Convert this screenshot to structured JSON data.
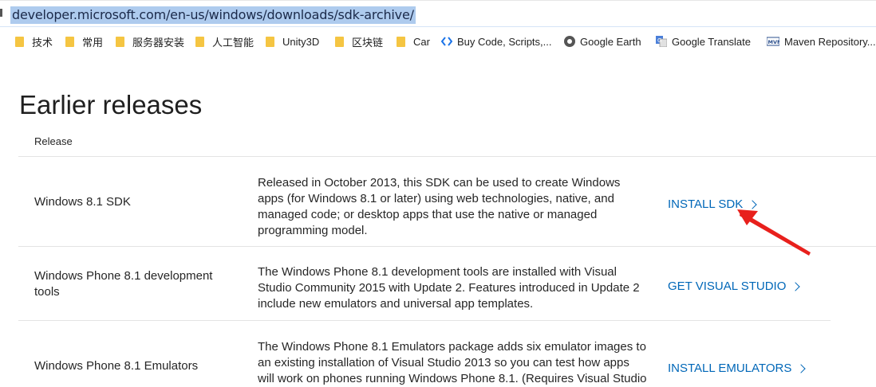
{
  "browser": {
    "url": "developer.microsoft.com/en-us/windows/downloads/sdk-archive/",
    "bookmarks": [
      {
        "label": "技术",
        "icon": "folder-icon"
      },
      {
        "label": "常用",
        "icon": "folder-icon"
      },
      {
        "label": "服务器安装",
        "icon": "folder-icon"
      },
      {
        "label": "人工智能",
        "icon": "folder-icon"
      },
      {
        "label": "Unity3D",
        "icon": "folder-icon"
      },
      {
        "label": "区块链",
        "icon": "folder-icon"
      },
      {
        "label": "Car",
        "icon": "folder-icon"
      },
      {
        "label": "Buy Code, Scripts,...",
        "icon": "codecanyon-icon"
      },
      {
        "label": "Google Earth",
        "icon": "globe-icon"
      },
      {
        "label": "Google Translate",
        "icon": "translate-icon"
      },
      {
        "label": "Maven Repository...",
        "icon": "maven-icon"
      }
    ]
  },
  "page": {
    "title": "Earlier releases",
    "column_header": "Release",
    "rows": [
      {
        "name": "Windows 8.1 SDK",
        "description": "Released in October 2013, this SDK can be used to create Windows apps (for Windows 8.1 or later) using web technologies, native, and managed code; or desktop apps that use the native or managed programming model.",
        "action": "INSTALL SDK"
      },
      {
        "name": "Windows Phone 8.1 development tools",
        "description": "The Windows Phone 8.1 development tools are installed with Visual Studio Community 2015 with Update 2. Features introduced in Update 2 include new emulators and universal app templates.",
        "action": "GET VISUAL STUDIO"
      },
      {
        "name": "Windows Phone 8.1 Emulators",
        "description": "The Windows Phone 8.1 Emulators package adds six emulator images to an existing installation of Visual Studio 2013 so you can test how apps will work on phones running Windows Phone 8.1. (Requires Visual Studio",
        "action": "INSTALL EMULATORS"
      }
    ]
  },
  "colors": {
    "link": "#0067b8",
    "url_highlight": "#aecbee",
    "annotation_arrow": "#e8201c",
    "folder": "#f5c542"
  }
}
